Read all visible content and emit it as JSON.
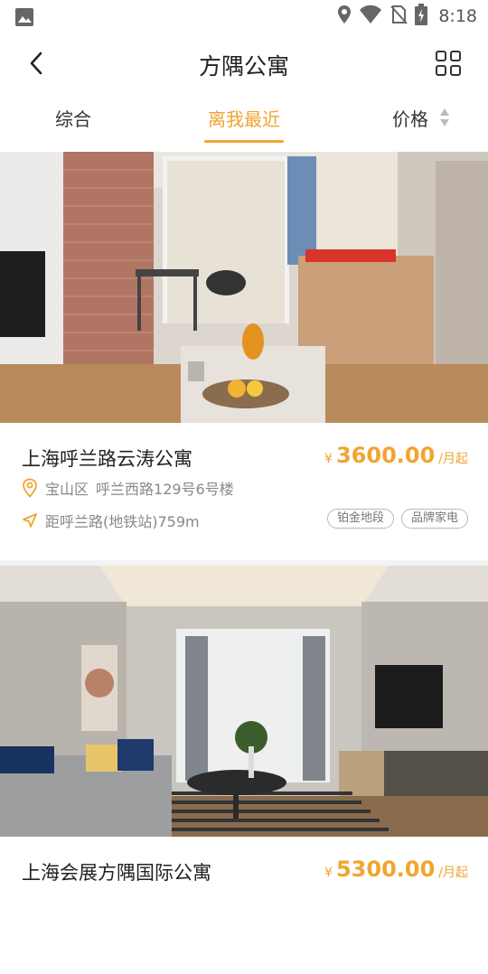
{
  "status_bar": {
    "time": "8:18",
    "icons": [
      "image-icon",
      "location-icon",
      "wifi-icon",
      "no-sim-icon",
      "battery-charging-icon"
    ]
  },
  "header": {
    "title": "方隅公寓",
    "back_icon": "back-arrow-icon",
    "grid_icon": "grid-view-icon"
  },
  "tabs": [
    {
      "label": "综合",
      "active": false
    },
    {
      "label": "离我最近",
      "active": true
    },
    {
      "label": "价格",
      "active": false,
      "icon": "sort-arrows-icon"
    }
  ],
  "colors": {
    "accent": "#f0a530",
    "text_primary": "#222222",
    "text_secondary": "#888888",
    "divider": "#f3f3f3"
  },
  "listings": [
    {
      "name": "上海呼兰路云涛公寓",
      "price_currency": "¥",
      "price": "3600.00",
      "price_unit": "/月起",
      "district": "宝山区",
      "address": "呼兰西路129号6号楼",
      "distance": "距呼兰路(地铁站)759m",
      "tags": [
        "铂金地段",
        "品牌家电"
      ],
      "photo_icon": "apartment-photo"
    },
    {
      "name": "上海会展方隅国际公寓",
      "price_currency": "¥",
      "price": "5300.00",
      "price_unit": "/月起",
      "photo_icon": "apartment-photo"
    }
  ]
}
